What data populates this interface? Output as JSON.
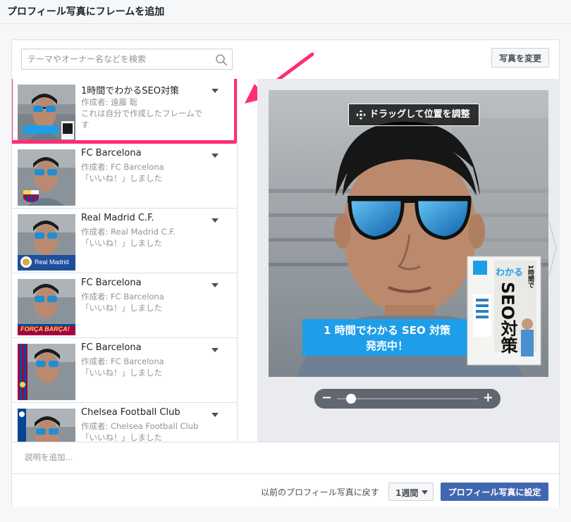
{
  "dialog": {
    "title": "プロフィール写真にフレームを追加"
  },
  "search": {
    "placeholder": "テーマやオーナー名などを検索"
  },
  "toolbar": {
    "change_photo_label": "写真を変更"
  },
  "frames": [
    {
      "title": "1時間でわかるSEO対策",
      "author": "作成者: 遠藤 聡",
      "note": "これは自分で作成したフレームです",
      "selected": true,
      "thumb": "seo-book"
    },
    {
      "title": "FC Barcelona",
      "author": "作成者: FC Barcelona",
      "note": "「いいね！」しました",
      "selected": false,
      "thumb": "barca-crest"
    },
    {
      "title": "Real Madrid C.F.",
      "author": "作成者: Real Madrid C.F.",
      "note": "「いいね！」しました",
      "selected": false,
      "thumb": "real-madrid-banner",
      "thumb_text": "Real Madrid"
    },
    {
      "title": "FC Barcelona",
      "author": "作成者: FC Barcelona",
      "note": "「いいね！」しました",
      "selected": false,
      "thumb": "forca-barca",
      "thumb_text": "FORÇA BARÇA!"
    },
    {
      "title": "FC Barcelona",
      "author": "作成者: FC Barcelona",
      "note": "「いいね！」しました",
      "selected": false,
      "thumb": "barca-stripes"
    },
    {
      "title": "Chelsea Football Club",
      "author": "作成者: Chelsea Football Club",
      "note": "「いいね！」しました",
      "selected": false,
      "thumb": "chelsea"
    }
  ],
  "preview": {
    "drag_label": "ドラッグして位置を調整",
    "banner_line1": "1 時間でわかる SEO 対策",
    "banner_line2": "発売中！",
    "book_title_lines": [
      "1時間で",
      "わかる",
      "SEO対策"
    ],
    "zoom_minus": "−",
    "zoom_plus": "+",
    "zoom_level": 0.1
  },
  "description": {
    "placeholder": "説明を追加..."
  },
  "footer": {
    "revert_label": "以前のプロフィール写真に戻す",
    "duration": "1週間",
    "set_button": "プロフィール写真に設定"
  },
  "colors": {
    "highlight": "#ff2d78",
    "primary": "#4267b2",
    "banner": "#1e9ee8"
  }
}
